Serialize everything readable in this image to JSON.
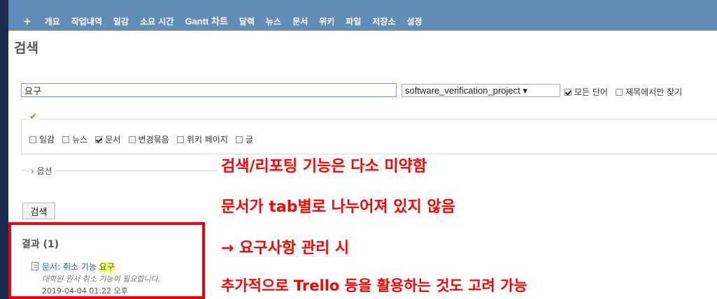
{
  "nav": {
    "items": [
      {
        "label": "+",
        "key": "plus"
      },
      {
        "label": "개요",
        "key": "overview"
      },
      {
        "label": "작업내역",
        "key": "activity"
      },
      {
        "label": "일감",
        "key": "issues"
      },
      {
        "label": "소요 시간",
        "key": "time"
      },
      {
        "label": "Gantt 차트",
        "key": "gantt"
      },
      {
        "label": "달력",
        "key": "calendar"
      },
      {
        "label": "뉴스",
        "key": "news"
      },
      {
        "label": "문서",
        "key": "documents"
      },
      {
        "label": "위키",
        "key": "wiki"
      },
      {
        "label": "파일",
        "key": "files"
      },
      {
        "label": "저장소",
        "key": "repository"
      },
      {
        "label": "설정",
        "key": "settings"
      }
    ]
  },
  "page_title": "검색",
  "search": {
    "value": "요구",
    "project_select": "software_verification_project ▾",
    "all_words_label": "모든 단어",
    "all_words_checked": true,
    "titles_only_label": "제목에서만 찾기",
    "titles_only_checked": false
  },
  "scopes": [
    {
      "label": "일감",
      "checked": false
    },
    {
      "label": "뉴스",
      "checked": false
    },
    {
      "label": "문서",
      "checked": true
    },
    {
      "label": "변경묶음",
      "checked": false
    },
    {
      "label": "위키 페이지",
      "checked": false
    },
    {
      "label": "글",
      "checked": false
    }
  ],
  "options_toggle": "› 옵션",
  "submit_label": "검색",
  "results": {
    "title": "결과 (1)",
    "items": [
      {
        "prefix": "문서: 취소 기능 ",
        "highlight": "요구",
        "description": "대학원 원서 취소 기능이 필요합니다.",
        "time": "2019-04-04 01:22 오후"
      }
    ]
  },
  "annotations": [
    "검색/리포팅 기능은 다소 미약함",
    "문서가 tab별로 나누어져 있지 않음",
    "→ 요구사항 관리 시",
    "추가적으로 Trello 등을 활용하는 것도 고려 가능"
  ],
  "colors": {
    "background": "#1b2d4f",
    "nav": "#628db6",
    "annotation": "#ff0000",
    "results_border": "#e60012",
    "highlight": "#ffff66",
    "check_icon": "#5fa33f"
  }
}
